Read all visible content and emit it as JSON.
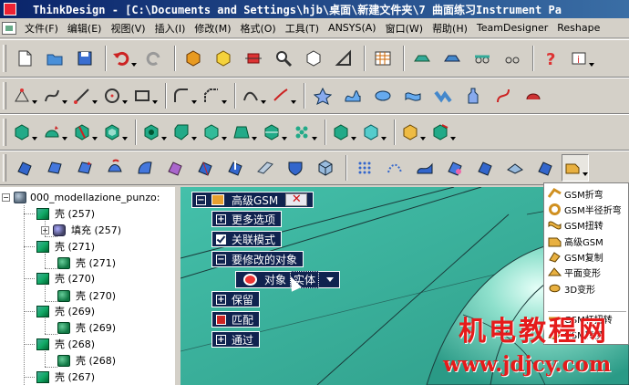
{
  "title_bar": {
    "text": "ThinkDesign - [C:\\Documents and Settings\\hjb\\桌面\\新建文件夹\\7 曲面练习Instrument Pa"
  },
  "menu": {
    "items": [
      "文件(F)",
      "编辑(E)",
      "视图(V)",
      "插入(I)",
      "修改(M)",
      "格式(O)",
      "工具(T)",
      "ANSYS(A)",
      "窗口(W)",
      "帮助(H)",
      "TeamDesigner",
      "Reshape"
    ]
  },
  "tree": {
    "root": "000_modellazione_punzo:",
    "rows": [
      {
        "label": "壳  (257)",
        "level": 1,
        "icon": "shell-icon"
      },
      {
        "label": "填充  (257)",
        "level": 2,
        "icon": "fill-icon"
      },
      {
        "label": "壳  (271)",
        "level": 1,
        "icon": "shell-icon"
      },
      {
        "label": "壳  (271)",
        "level": 2,
        "icon": "sub-shell-icon"
      },
      {
        "label": "壳  (270)",
        "level": 1,
        "icon": "shell-icon"
      },
      {
        "label": "壳  (270)",
        "level": 2,
        "icon": "sub-shell-icon"
      },
      {
        "label": "壳  (269)",
        "level": 1,
        "icon": "shell-icon"
      },
      {
        "label": "壳  (269)",
        "level": 2,
        "icon": "sub-shell-icon"
      },
      {
        "label": "壳  (268)",
        "level": 1,
        "icon": "shell-icon"
      },
      {
        "label": "壳  (268)",
        "level": 2,
        "icon": "sub-shell-icon"
      },
      {
        "label": "壳  (267)",
        "level": 1,
        "icon": "shell-icon"
      }
    ]
  },
  "command_panel": {
    "title": "高级GSM",
    "close": "✕",
    "more_options": "更多选项",
    "associative": "关联模式",
    "objects_to_modify": "要修改的对象",
    "object_label": "对象",
    "object_value": "实体",
    "keep": "保留",
    "match": "匹配",
    "through": "通过"
  },
  "popup_menu": {
    "items": [
      "GSM折弯",
      "GSM半径折弯",
      "GSM扭转",
      "高级GSM",
      "GSM复制",
      "平面变形",
      "3D变形",
      "GSM杆扭转",
      "GSM转换"
    ]
  },
  "watermark": {
    "title": "机电教程网",
    "url": "www.jdjcy.com"
  }
}
